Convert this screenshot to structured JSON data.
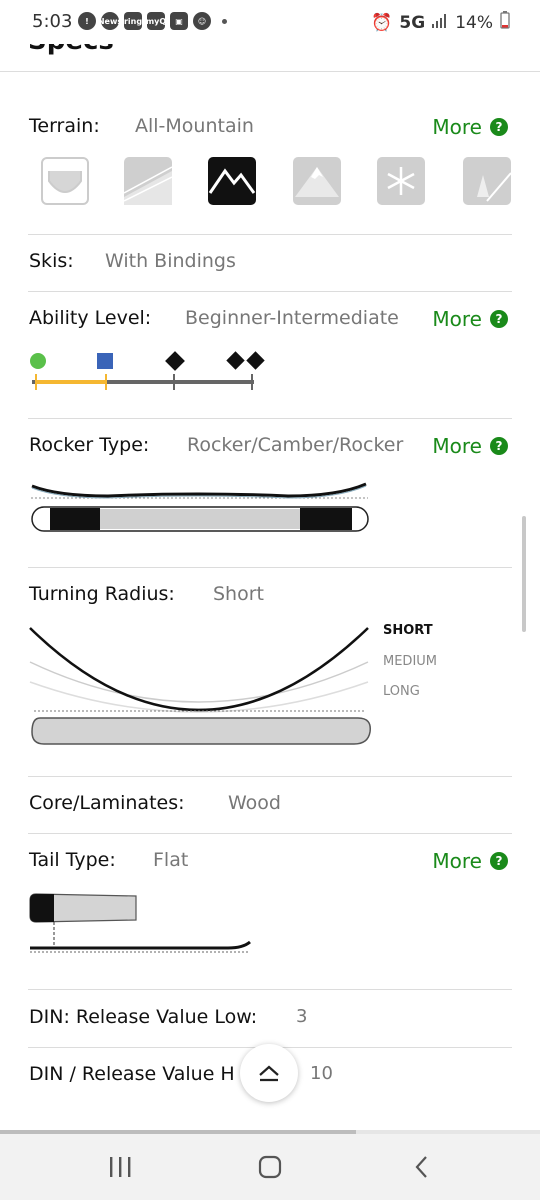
{
  "status": {
    "time": "5:03",
    "notif_icons": [
      "alert-icon",
      "news-icon",
      "ring-icon",
      "myq-icon",
      "gallery-icon",
      "face-icon"
    ],
    "notif_text": [
      "!",
      "News",
      "ring",
      "myQ",
      "▣",
      "☺"
    ],
    "network": "5G",
    "battery": "14%"
  },
  "header": {
    "title": "Specs"
  },
  "specs": {
    "terrain": {
      "label": "Terrain:",
      "value": "All-Mountain",
      "more": "More"
    },
    "terrain_tiles": [
      "Park",
      "Groomers",
      "All-Mountain",
      "Big Mountain",
      "Powder",
      "Backcountry"
    ],
    "terrain_selected_index": 2,
    "skis": {
      "label": "Skis:",
      "value": "With Bindings"
    },
    "ability": {
      "label": "Ability Level:",
      "value": "Beginner-Intermediate",
      "more": "More"
    },
    "rocker": {
      "label": "Rocker Type:",
      "value": "Rocker/Camber/Rocker",
      "more": "More"
    },
    "turning": {
      "label": "Turning Radius:",
      "value": "Short",
      "legend": [
        "SHORT",
        "MEDIUM",
        "LONG"
      ]
    },
    "core": {
      "label": "Core/Laminates:",
      "value": "Wood"
    },
    "tail": {
      "label": "Tail Type:",
      "value": "Flat",
      "more": "More"
    },
    "din_low": {
      "label": "DIN: Release Value Low:",
      "value": "3"
    },
    "din_high": {
      "label": "DIN / Release Value H",
      "value": "10"
    }
  },
  "colors": {
    "accent_green": "#1a8a1a",
    "ability_range": "#f5b731"
  },
  "page_progress": 0.66
}
